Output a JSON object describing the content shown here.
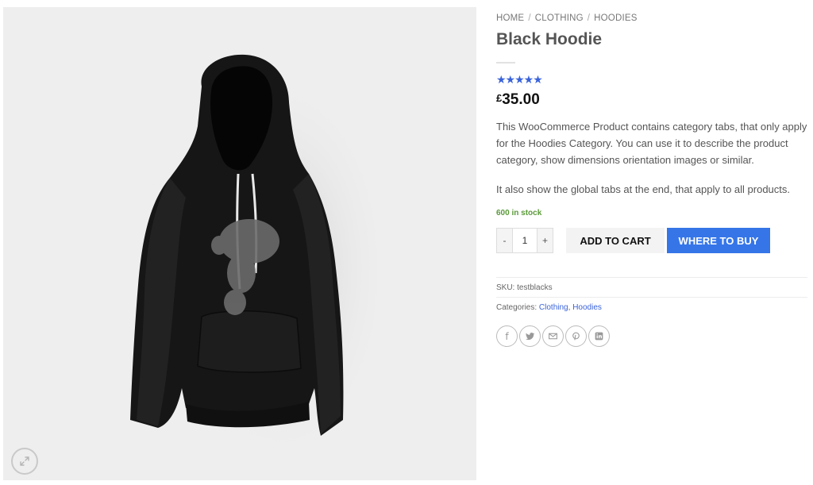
{
  "product": {
    "image_alt": "Black Hoodie product photo",
    "zoom_icon": "expand-arrows-icon"
  },
  "breadcrumb": {
    "home": "HOME",
    "sep1": "/",
    "clothing": "CLOTHING",
    "sep2": "/",
    "hoodies": "HOODIES"
  },
  "title": "Black Hoodie",
  "rating": {
    "stars": "★★★★★",
    "value": 5,
    "max": 5,
    "color": "#3a63d9"
  },
  "price": {
    "currency": "£",
    "amount": "35.00"
  },
  "description": "This WooCommerce Product contains category tabs, that only apply for the Hoodies Category. You can use it to describe the product category, show dimensions orientation images or similar.",
  "description2": "It also show the global tabs at the end, that apply to all products.",
  "stock": "600 in stock",
  "quantity": {
    "minus": "-",
    "value": "1",
    "plus": "+"
  },
  "buttons": {
    "add_to_cart": "ADD TO CART",
    "where_to_buy": "WHERE TO BUY",
    "where_to_buy_color": "#3575e8"
  },
  "meta": {
    "sku_label": "SKU:",
    "sku_value": "testblacks",
    "categories_label": "Categories:",
    "category_1": "Clothing",
    "category_sep": ",",
    "category_2": "Hoodies"
  },
  "share": {
    "icons": [
      "facebook-icon",
      "twitter-icon",
      "email-icon",
      "pinterest-icon",
      "linkedin-icon"
    ],
    "facebook_glyph": "f"
  }
}
